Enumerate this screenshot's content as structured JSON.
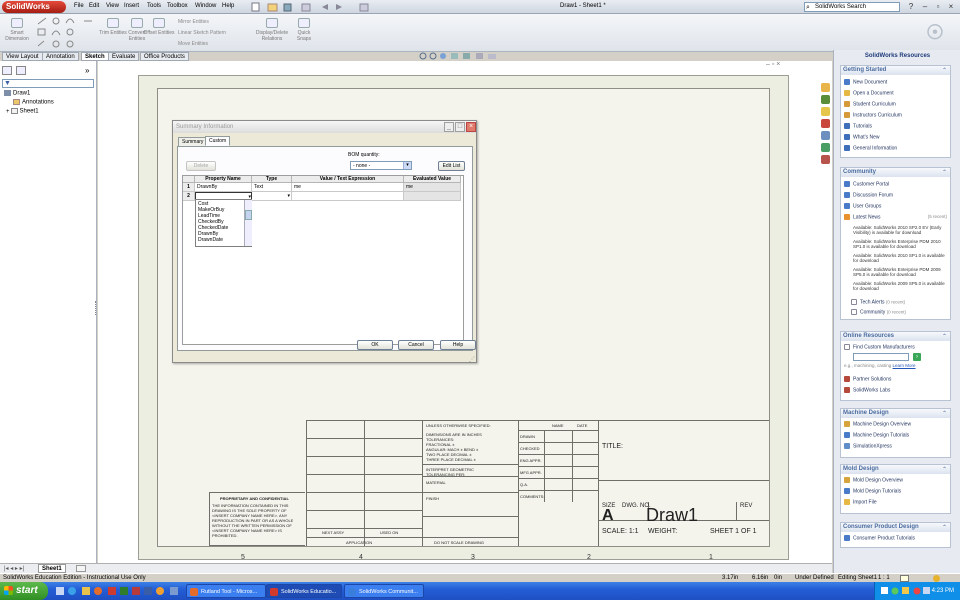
{
  "app": {
    "logo": "SolidWorks",
    "menu": [
      "File",
      "Edit",
      "View",
      "Insert",
      "Tools",
      "Toolbox",
      "Window",
      "Help"
    ],
    "document_title": "Draw1 - Sheet1 *",
    "search_placeholder": "SolidWorks Search",
    "help_label": "?"
  },
  "command_manager": {
    "items": [
      "Smart Dimension",
      "Trim Entities",
      "Convert Entities",
      "Offset Entities",
      "Mirror Entities",
      "Linear Sketch Pattern",
      "Move Entities",
      "Display/Delete Relations",
      "Quick Snaps"
    ],
    "tabs": [
      "View Layout",
      "Annotation",
      "Sketch",
      "Evaluate",
      "Office Products"
    ],
    "active_tab": "Sketch"
  },
  "feature_tree": {
    "items": [
      "Draw1",
      "Annotations",
      "Sheet1"
    ]
  },
  "sheet": {
    "zone_labels": [
      "5",
      "4",
      "3",
      "2",
      "1"
    ],
    "title_block": {
      "tolerances": [
        "UNLESS OTHERWISE SPECIFIED:",
        "DIMENSIONS ARE IN INCHES",
        "TOLERANCES:",
        "FRACTIONAL ±",
        "ANGULAR: MACH ±   BEND ±",
        "TWO PLACE DECIMAL   ±",
        "THREE PLACE DECIMAL  ±"
      ],
      "geometric": [
        "INTERPRET GEOMETRIC",
        "TOLERANCING PER:"
      ],
      "material": "MATERIAL",
      "finish": "FINISH",
      "do_not_scale": "DO NOT SCALE DRAWING",
      "rows": [
        "DRAWN",
        "CHECKED",
        "ENG APPR.",
        "MFG APPR.",
        "Q.A.",
        "COMMENTS:"
      ],
      "name_col": "NAME",
      "date_col": "DATE",
      "title": "TITLE:",
      "size_label": "SIZE",
      "dwg_no_label": "DWG.  NO.",
      "rev_label": "REV",
      "size_value": "A",
      "dwg_no_value": "Draw1",
      "scale": "SCALE: 1:1",
      "weight": "WEIGHT:",
      "sheet_of": "SHEET 1 OF 1",
      "next_assy": "NEXT ASSY",
      "used_on": "USED ON",
      "application": "APPLICATION",
      "proprietary_title": "PROPRIETARY AND CONFIDENTIAL",
      "proprietary_text": [
        "THE INFORMATION CONTAINED IN THIS",
        "DRAWING IS THE SOLE PROPERTY OF",
        "<INSERT COMPANY NAME HERE>. ANY",
        "REPRODUCTION IN PART OR AS A WHOLE",
        "WITHOUT THE WRITTEN PERMISSION OF",
        "<INSERT COMPANY NAME HERE> IS",
        "PROHIBITED."
      ]
    }
  },
  "dialog": {
    "title": "Summary Information",
    "tabs": [
      "Summary",
      "Custom"
    ],
    "active_tab": "Custom",
    "delete_label": "Delete",
    "bom_label": "BOM quantity:",
    "bom_value": "- none -",
    "edit_list_label": "Edit List",
    "columns": [
      "Property Name",
      "Type",
      "Value / Text Expression",
      "Evaluated Value"
    ],
    "rows": [
      {
        "num": "1",
        "name": "DrawnBy",
        "type": "Text",
        "value": "me",
        "evaluated": "me"
      },
      {
        "num": "2",
        "name": "",
        "type": "",
        "value": "",
        "evaluated": ""
      }
    ],
    "dropdown_options": [
      "Cost",
      "MakeOrBuy",
      "LeadTime",
      "CheckedBy",
      "CheckedDate",
      "DrawnBy",
      "DrawnDate"
    ],
    "ok_label": "OK",
    "cancel_label": "Cancel",
    "help_label": "Help"
  },
  "resources": {
    "title": "SolidWorks Resources",
    "getting_started": {
      "title": "Getting Started",
      "items": [
        "New Document",
        "Open a Document",
        "Student Curriculum",
        "Instructors Curriculum",
        "Tutorials",
        "What's New",
        "General Information"
      ]
    },
    "community": {
      "title": "Community",
      "items": [
        "Customer Portal",
        "Discussion Forum",
        "User Groups"
      ],
      "latest_news": "Latest News",
      "latest_news_count": "(5 recent)",
      "news": [
        "Available: SolidWorks 2010 SP2.0 EV (Early Visibility) is available for download",
        "Available: SolidWorks Enterprise PDM 2010 SP1.0 is available for download",
        "Available: SolidWorks 2010 SP1.0 is available for download",
        "Available: SolidWorks Enterprise PDM 2009 SP5.0 is available for download",
        "Available: SolidWorks 2009 SP5.0 is available for download"
      ],
      "tech_alerts": "Tech Alerts",
      "tech_alerts_count": "(0 recent)",
      "community_link": "Community",
      "community_count": "(0 recent)"
    },
    "online": {
      "title": "Online Resources",
      "find_label": "Find Custom Manufacturers",
      "hint": "e.g., machining, casting",
      "learn_more": "Learn More",
      "items": [
        "Partner Solutions",
        "SolidWorks Labs"
      ]
    },
    "machine_design": {
      "title": "Machine Design",
      "items": [
        "Machine Design Overview",
        "Machine Design Tutorials",
        "SimulationXpress"
      ]
    },
    "mold_design": {
      "title": "Mold Design",
      "items": [
        "Mold Design Overview",
        "Mold Design Tutorials",
        "Import File"
      ]
    },
    "consumer": {
      "title": "Consumer Product Design",
      "items": [
        "Consumer Product Tutorials"
      ]
    }
  },
  "status": {
    "left": "SolidWorks Education Edition - Instructional Use Only",
    "x": "3.17in",
    "y": "6.16in",
    "z": "0in",
    "state": "Under Defined",
    "editing": "Editing Sheet1",
    "scale": "1 : 1",
    "sheet_tab": "Sheet1"
  },
  "taskbar": {
    "start": "start",
    "tasks": [
      "Rutland Tool - Micros...",
      "SolidWorks Educatio...",
      "SolidWorks Communit..."
    ],
    "clock": "4:23 PM"
  }
}
